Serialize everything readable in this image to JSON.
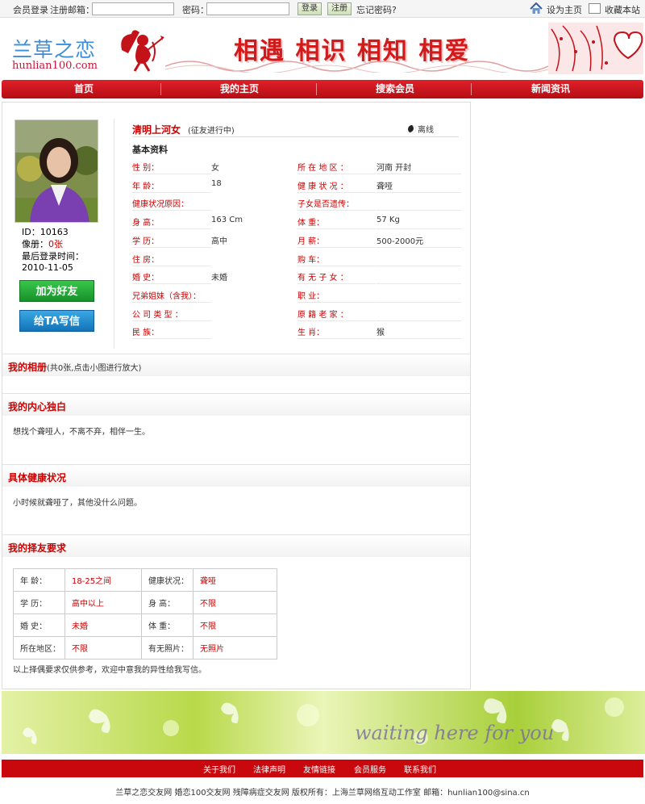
{
  "topbar": {
    "login_label": "会员登录",
    "email_label": "注册邮箱：",
    "email_value": "",
    "password_label": "密码：",
    "password_value": "",
    "login_button": "登录",
    "register_button": "注册",
    "forgot_link": "忘记密码?",
    "set_home": "设为主页",
    "bookmark": "收藏本站"
  },
  "banner": {
    "logo_cn": "兰草之恋",
    "logo_url": "hunlian100.com",
    "slogan": "相遇 相识 相知 相爱"
  },
  "nav": [
    "首页",
    "我的主页",
    "搜索会员",
    "新闻资讯"
  ],
  "profile": {
    "id_line": "ID：10163",
    "album_label": "像册：",
    "album_value": "0张",
    "last_login_label": "最后登录时间：",
    "last_login_value": "2010-11-05",
    "add_friend": "加为好友",
    "write_mail": "给TA写信",
    "name": "清明上河女",
    "status": "(征友进行中)",
    "online": "离线",
    "basic_title": "基本资料",
    "left_fields": [
      {
        "label": "性    别：",
        "value": "女"
      },
      {
        "label": "年    龄：",
        "value": "18"
      },
      {
        "label": "健康状况原因：",
        "value": ""
      },
      {
        "label": "身    高：",
        "value": "163 Cm"
      },
      {
        "label": "学    历：",
        "value": "高中"
      },
      {
        "label": "住    房：",
        "value": ""
      },
      {
        "label": "婚    史：",
        "value": "未婚"
      },
      {
        "label": "兄弟姐妹（含我）：",
        "value": ""
      },
      {
        "label": "公  司  类  型  ：",
        "value": ""
      },
      {
        "label": "民    族：",
        "value": ""
      }
    ],
    "right_fields": [
      {
        "label": "所  在  地  区  ：",
        "value": "河南  开封"
      },
      {
        "label": "健  康  状  况  ：",
        "value": "聋哑"
      },
      {
        "label": "子女是否遗传：",
        "value": ""
      },
      {
        "label": "体    重：",
        "value": "57 Kg"
      },
      {
        "label": "月    薪：",
        "value": "500-2000元"
      },
      {
        "label": "购    车：",
        "value": ""
      },
      {
        "label": "有  无  子  女  ：",
        "value": ""
      },
      {
        "label": "职    业：",
        "value": ""
      },
      {
        "label": "原  籍  老  家  ：",
        "value": ""
      },
      {
        "label": "生    肖：",
        "value": "猴"
      }
    ]
  },
  "sections": {
    "album_title": "我的相册",
    "album_sub": "(共0张,点击小图进行放大)",
    "monologue_title": "我的内心独白",
    "monologue_text": "想找个聋哑人，不离不弃，相伴一生。",
    "health_title": "具体健康状况",
    "health_text": "小时候就聋哑了，其他没什么问题。",
    "req_title": "我的择友要求"
  },
  "requirements": [
    [
      {
        "l": "年    龄：",
        "v": "18-25之间"
      },
      {
        "l": "健康状况：",
        "v": "聋哑"
      }
    ],
    [
      {
        "l": "学    历：",
        "v": "高中以上"
      },
      {
        "l": "身    高：",
        "v": "不限"
      }
    ],
    [
      {
        "l": "婚    史：",
        "v": "未婚"
      },
      {
        "l": "体    重：",
        "v": "不限"
      }
    ],
    [
      {
        "l": "所在地区：",
        "v": "不限"
      },
      {
        "l": "有无照片：",
        "v": "无照片"
      }
    ]
  ],
  "req_note": "以上择偶要求仅供参考，欢迎中意我的异性给我写信。",
  "footer": {
    "banner_text": "waiting  here for you",
    "links": [
      "关于我们",
      "法律声明",
      "友情链接",
      "会员服务",
      "联系我们"
    ],
    "copyright": "兰草之恋交友网  婚恋100交友网  残障病症交友网  版权所有：上海兰草网络互动工作室  邮箱：hunlian100@sina.cn"
  },
  "colors": {
    "accent_red": "#c00000",
    "nav_red": "#c8080c",
    "green_button": "#1f9f33",
    "blue_button": "#1a85cc"
  }
}
